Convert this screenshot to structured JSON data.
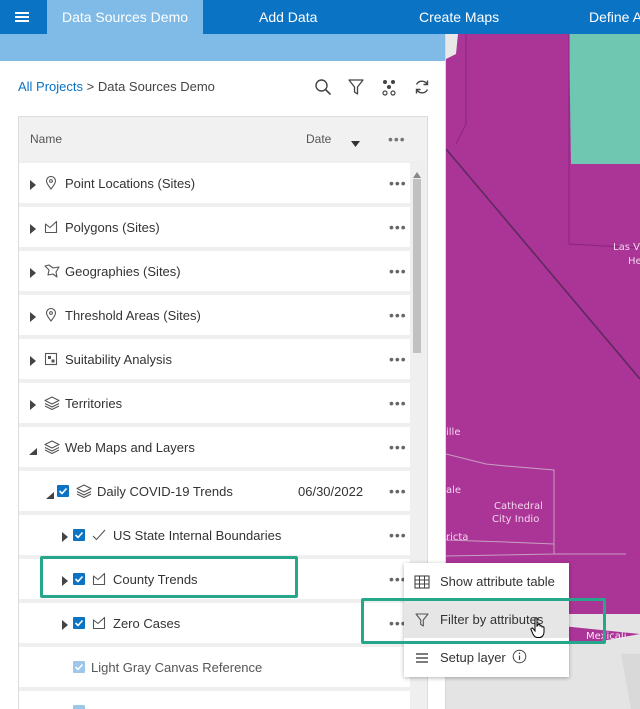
{
  "nav": {
    "tabs": [
      {
        "label": "Data Sources Demo"
      },
      {
        "label": "Add Data"
      },
      {
        "label": "Create Maps"
      },
      {
        "label": "Define A"
      }
    ]
  },
  "breadcrumb": {
    "root": "All Projects",
    "sep": " > ",
    "current": "Data Sources Demo"
  },
  "tree": {
    "header": {
      "name": "Name",
      "date": "Date",
      "more": "•••"
    },
    "rows": [
      {
        "label": "Point Locations (Sites)",
        "icon": "map-pin-icon"
      },
      {
        "label": "Polygons (Sites)",
        "icon": "polygon-icon"
      },
      {
        "label": "Geographies (Sites)",
        "icon": "geography-icon"
      },
      {
        "label": "Threshold Areas (Sites)",
        "icon": "map-pin-icon"
      },
      {
        "label": "Suitability Analysis",
        "icon": "suitability-icon"
      },
      {
        "label": "Territories",
        "icon": "layers-icon"
      },
      {
        "label": "Web Maps and Layers",
        "icon": "layers-icon"
      },
      {
        "label": "Daily COVID-19 Trends",
        "icon": "layers-icon",
        "date": "06/30/2022"
      },
      {
        "label": "US State Internal Boundaries",
        "icon": "line-icon"
      },
      {
        "label": "County Trends",
        "icon": "polygon-icon"
      },
      {
        "label": "Zero Cases",
        "icon": "polygon-icon"
      },
      {
        "label": "Light Gray Canvas Reference"
      }
    ],
    "more": "•••"
  },
  "map": {
    "labels": [
      "Las V",
      "He",
      "ille",
      "ale",
      "Cathedral",
      "City Indio",
      "ricta",
      "Mexicali"
    ],
    "color": "#ab3497"
  },
  "context_menu": {
    "items": [
      {
        "label": "Show attribute table",
        "icon": "table-icon"
      },
      {
        "label": "Filter by attributes",
        "icon": "filter-icon"
      },
      {
        "label": "Setup layer",
        "icon": "list-icon"
      }
    ]
  }
}
